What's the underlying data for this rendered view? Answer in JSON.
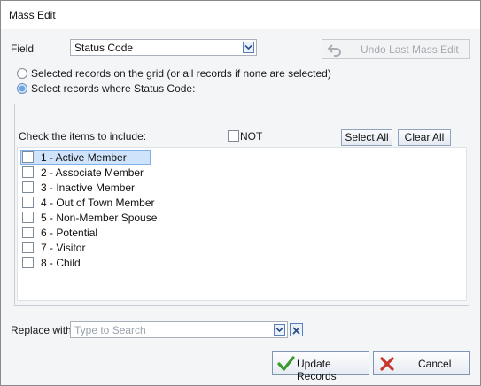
{
  "window": {
    "title": "Mass Edit"
  },
  "field": {
    "label": "Field",
    "value": "Status Code"
  },
  "undo_button": {
    "label": "Undo Last Mass Edit"
  },
  "scope": {
    "option_grid": "Selected records on the grid (or all records if none are selected)",
    "option_where": "Select records where Status Code:",
    "selected": "option_where"
  },
  "include": {
    "label": "Check the items to include:",
    "not_label": "NOT",
    "select_all": "Select All",
    "clear_all": "Clear All",
    "items": [
      {
        "label": "1 - Active Member",
        "checked": false,
        "highlighted": true
      },
      {
        "label": "2 - Associate Member",
        "checked": false
      },
      {
        "label": "3 - Inactive Member",
        "checked": false
      },
      {
        "label": "4 - Out of Town Member",
        "checked": false
      },
      {
        "label": "5 - Non-Member Spouse",
        "checked": false
      },
      {
        "label": "6 - Potential",
        "checked": false
      },
      {
        "label": "7 - Visitor",
        "checked": false
      },
      {
        "label": "8 - Child",
        "checked": false
      }
    ]
  },
  "replace": {
    "label": "Replace with",
    "placeholder": "Type to Search",
    "value": ""
  },
  "actions": {
    "update": "Update Records",
    "cancel": "Cancel"
  },
  "colors": {
    "accent": "#4a78b5",
    "check_green": "#3a9a2e",
    "cancel_red": "#c8362c"
  }
}
